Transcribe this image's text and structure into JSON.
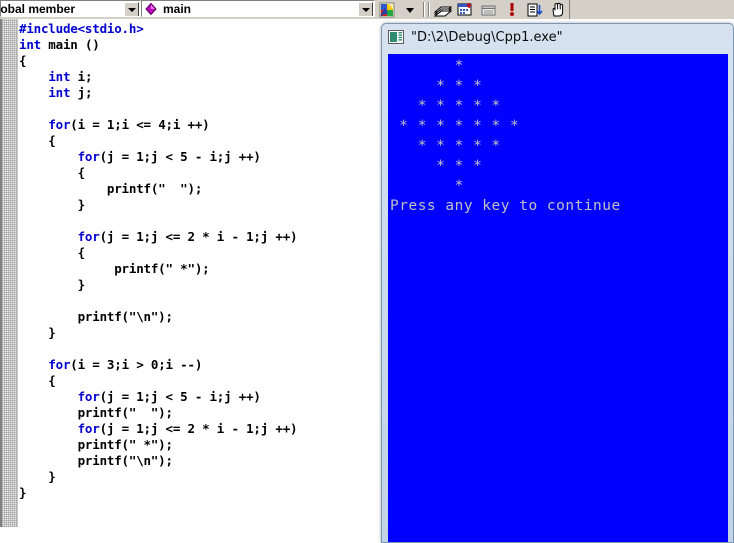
{
  "toolbar": {
    "scope_combo": {
      "name": "global-members-combo",
      "value": "lobal member",
      "arrow_icon": "chevron-down-icon"
    },
    "symbol_combo": {
      "name": "symbol-combo",
      "value": "main",
      "icon": "member-function-diamond-icon",
      "arrow_icon": "chevron-down-icon"
    },
    "buttons": [
      {
        "name": "wizard-bar-icon",
        "label": "WizardBar"
      },
      {
        "name": "wizardbar-dropdown-icon",
        "label": "WizardBar Actions"
      },
      {
        "name": "class-wizard-icon",
        "label": "ClassWizard"
      },
      {
        "name": "new-class-icon",
        "label": "New Class"
      },
      {
        "name": "new-form-icon",
        "label": "New Form"
      },
      {
        "name": "add-member-variable-icon",
        "label": "Add Member Variable"
      },
      {
        "name": "go-to-definition-icon",
        "label": "Go To Definition"
      },
      {
        "name": "hand-pan-icon",
        "label": "Pan"
      }
    ]
  },
  "editor": {
    "name": "source-code-editor",
    "filename_symbol": "main",
    "lines": [
      [
        {
          "t": "#include<stdio.h>",
          "c": "pp"
        }
      ],
      [
        {
          "t": "int",
          "c": "kw"
        },
        {
          "t": " main ()",
          "c": ""
        }
      ],
      [
        {
          "t": "{",
          "c": ""
        }
      ],
      [
        {
          "t": "    ",
          "c": ""
        },
        {
          "t": "int",
          "c": "kw"
        },
        {
          "t": " i;",
          "c": ""
        }
      ],
      [
        {
          "t": "    ",
          "c": ""
        },
        {
          "t": "int",
          "c": "kw"
        },
        {
          "t": " j;",
          "c": ""
        }
      ],
      [
        {
          "t": "",
          "c": ""
        }
      ],
      [
        {
          "t": "    ",
          "c": ""
        },
        {
          "t": "for",
          "c": "kw"
        },
        {
          "t": "(i = 1;i <= 4;i ++)",
          "c": ""
        }
      ],
      [
        {
          "t": "    {",
          "c": ""
        }
      ],
      [
        {
          "t": "        ",
          "c": ""
        },
        {
          "t": "for",
          "c": "kw"
        },
        {
          "t": "(j = 1;j < 5 - i;j ++)",
          "c": ""
        }
      ],
      [
        {
          "t": "        {",
          "c": ""
        }
      ],
      [
        {
          "t": "            printf(\"  \");",
          "c": ""
        }
      ],
      [
        {
          "t": "        }",
          "c": ""
        }
      ],
      [
        {
          "t": "",
          "c": ""
        }
      ],
      [
        {
          "t": "        ",
          "c": ""
        },
        {
          "t": "for",
          "c": "kw"
        },
        {
          "t": "(j = 1;j <= 2 * i - 1;j ++)",
          "c": ""
        }
      ],
      [
        {
          "t": "        {",
          "c": ""
        }
      ],
      [
        {
          "t": "             printf(\" *\");",
          "c": ""
        }
      ],
      [
        {
          "t": "        }",
          "c": ""
        }
      ],
      [
        {
          "t": "",
          "c": ""
        }
      ],
      [
        {
          "t": "        printf(\"\\n\");",
          "c": ""
        }
      ],
      [
        {
          "t": "    }",
          "c": ""
        }
      ],
      [
        {
          "t": "",
          "c": ""
        }
      ],
      [
        {
          "t": "    ",
          "c": ""
        },
        {
          "t": "for",
          "c": "kw"
        },
        {
          "t": "(i = 3;i > 0;i --)",
          "c": ""
        }
      ],
      [
        {
          "t": "    {",
          "c": ""
        }
      ],
      [
        {
          "t": "        ",
          "c": ""
        },
        {
          "t": "for",
          "c": "kw"
        },
        {
          "t": "(j = 1;j < 5 - i;j ++)",
          "c": ""
        }
      ],
      [
        {
          "t": "        printf(\"  \");",
          "c": ""
        }
      ],
      [
        {
          "t": "        ",
          "c": ""
        },
        {
          "t": "for",
          "c": "kw"
        },
        {
          "t": "(j = 1;j <= 2 * i - 1;j ++)",
          "c": ""
        }
      ],
      [
        {
          "t": "        printf(\" *\");",
          "c": ""
        }
      ],
      [
        {
          "t": "        printf(\"\\n\");",
          "c": ""
        }
      ],
      [
        {
          "t": "    }",
          "c": ""
        }
      ],
      [
        {
          "t": "}",
          "c": ""
        }
      ]
    ]
  },
  "console": {
    "name": "program-output-console",
    "title": "\"D:\\2\\Debug\\Cpp1.exe\"",
    "title_icon": "console-window-icon",
    "background_color": "#0000ff",
    "text_color": "#c0c0c0",
    "output_lines": [
      "       *",
      "     * * *",
      "   * * * * *",
      " * * * * * * *",
      "   * * * * *",
      "     * * *",
      "       *",
      "Press any key to continue"
    ]
  }
}
